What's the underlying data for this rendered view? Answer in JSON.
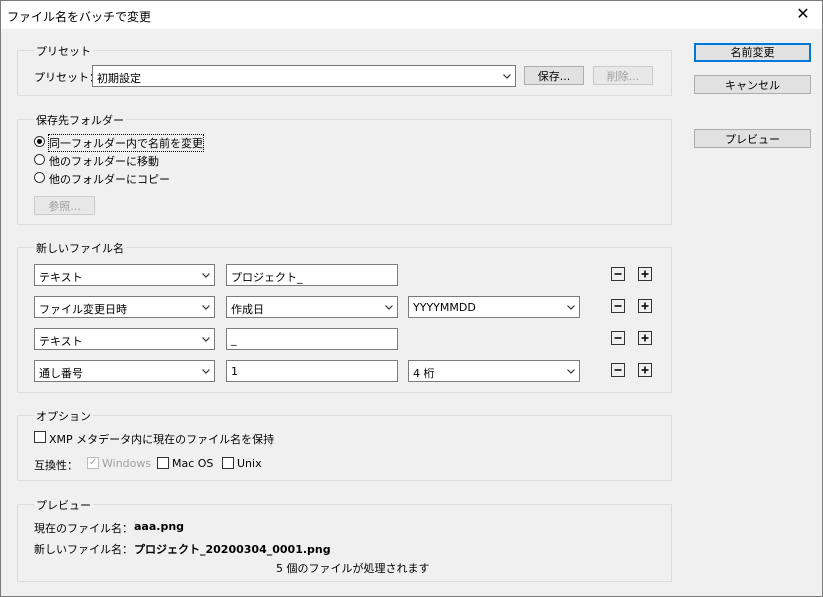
{
  "window": {
    "title": "ファイル名をバッチで変更",
    "close_glyph": "✕"
  },
  "buttons": {
    "rename": "名前変更",
    "cancel": "キャンセル",
    "preview": "プレビュー"
  },
  "preset": {
    "group_label": "プリセット",
    "field_label": "プリセット：",
    "value": "初期設定",
    "save": "保存...",
    "delete": "削除..."
  },
  "destination": {
    "group_label": "保存先フォルダー",
    "options": [
      {
        "label": "同一フォルダー内で名前を変更",
        "checked": true
      },
      {
        "label": "他のフォルダーに移動",
        "checked": false
      },
      {
        "label": "他のフォルダーにコピー",
        "checked": false
      }
    ],
    "browse": "参照..."
  },
  "new_name": {
    "group_label": "新しいファイル名",
    "rows": [
      {
        "type": "テキスト",
        "value": "プロジェクト_",
        "format": null
      },
      {
        "type": "ファイル変更日時",
        "value": "作成日",
        "format": "YYYYMMDD"
      },
      {
        "type": "テキスト",
        "value": "_",
        "format": null
      },
      {
        "type": "通し番号",
        "value": "1",
        "format": "4 桁"
      }
    ]
  },
  "options": {
    "group_label": "オプション",
    "xmp_label": "XMP メタデータ内に現在のファイル名を保持",
    "compat_label": "互換性：",
    "windows": "Windows",
    "macos": "Mac OS",
    "unix": "Unix"
  },
  "preview": {
    "group_label": "プレビュー",
    "current_label": "現在のファイル名：",
    "current_value": "aaa.png",
    "new_label": "新しいファイル名：",
    "new_value": "プロジェクト_20200304_0001.png",
    "count_text": "5 個のファイルが処理されます"
  },
  "icons": {
    "minus": "minus-icon",
    "plus": "plus-icon",
    "dropdown": "chevron-down-icon"
  }
}
